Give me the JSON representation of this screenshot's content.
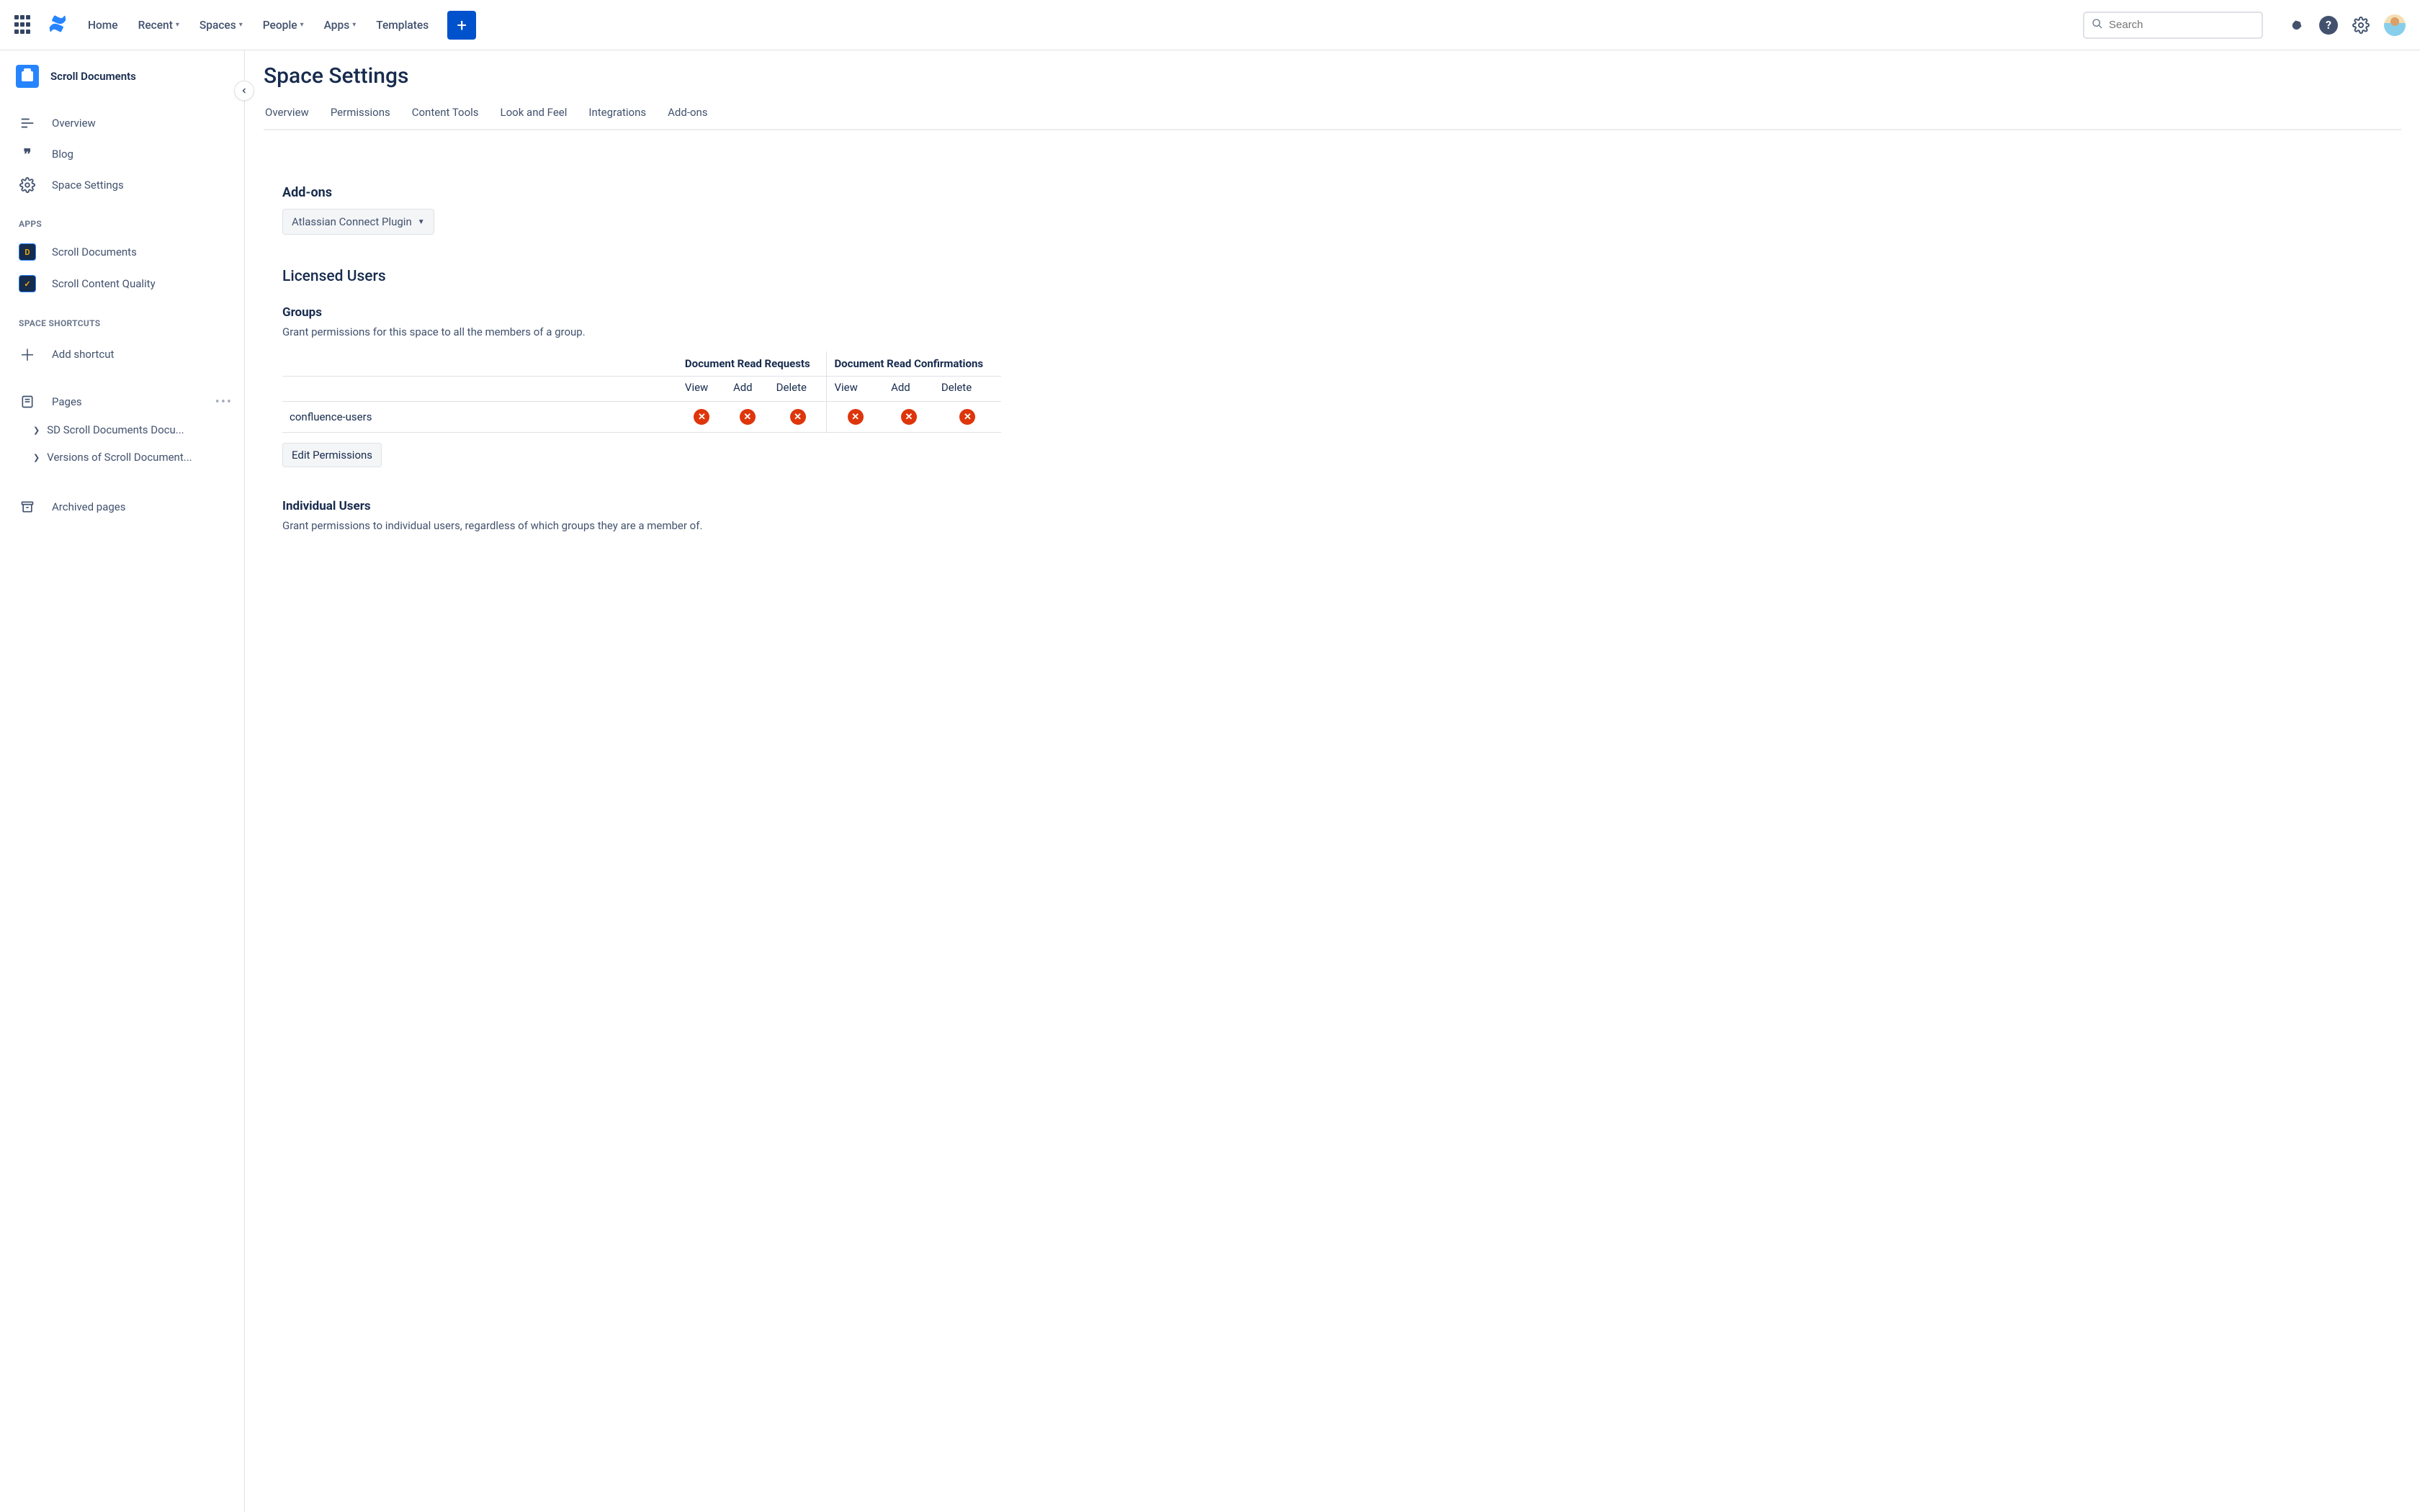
{
  "topnav": {
    "items": [
      {
        "label": "Home",
        "hasDropdown": false
      },
      {
        "label": "Recent",
        "hasDropdown": true
      },
      {
        "label": "Spaces",
        "hasDropdown": true
      },
      {
        "label": "People",
        "hasDropdown": true
      },
      {
        "label": "Apps",
        "hasDropdown": true
      },
      {
        "label": "Templates",
        "hasDropdown": false
      }
    ],
    "search_placeholder": "Search"
  },
  "sidebar": {
    "space_name": "Scroll Documents",
    "links": {
      "overview": "Overview",
      "blog": "Blog",
      "space_settings": "Space Settings"
    },
    "apps_label": "APPS",
    "apps": [
      {
        "label": "Scroll Documents"
      },
      {
        "label": "Scroll Content Quality"
      }
    ],
    "shortcuts_label": "SPACE SHORTCUTS",
    "add_shortcut": "Add shortcut",
    "pages_label": "Pages",
    "tree": [
      {
        "label": "SD Scroll Documents Docu..."
      },
      {
        "label": "Versions of Scroll Document..."
      }
    ],
    "archived": "Archived pages"
  },
  "main": {
    "title": "Space Settings",
    "tabs": [
      "Overview",
      "Permissions",
      "Content Tools",
      "Look and Feel",
      "Integrations",
      "Add-ons"
    ],
    "addons_heading": "Add-ons",
    "addons_dropdown": "Atlassian Connect Plugin",
    "licensed_heading": "Licensed Users",
    "groups_heading": "Groups",
    "groups_desc": "Grant permissions for this space to all the members of a group.",
    "perm_group_headers": [
      "Document Read Requests",
      "Document Read Confirmations"
    ],
    "perm_sub_headers": [
      "View",
      "Add",
      "Delete",
      "View",
      "Add",
      "Delete"
    ],
    "group_rows": [
      {
        "name": "confluence-users",
        "perms": [
          "deny",
          "deny",
          "deny",
          "deny",
          "deny",
          "deny"
        ]
      }
    ],
    "edit_permissions": "Edit Permissions",
    "individual_heading": "Individual Users",
    "individual_desc": "Grant permissions to individual users, regardless of which groups they are a member of."
  }
}
